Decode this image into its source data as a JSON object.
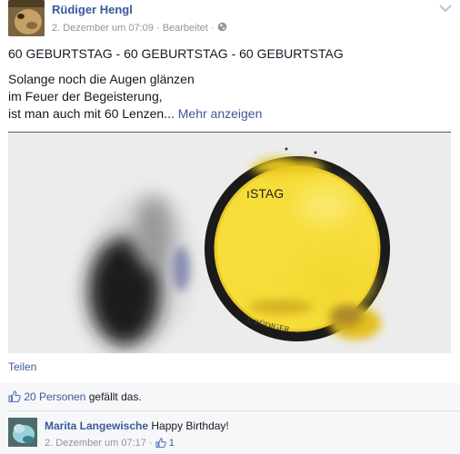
{
  "post": {
    "author_name": "Rüdiger Hengl",
    "date": "2. Dezember um 07:09",
    "separator": "·",
    "edited_label": "Bearbeitet",
    "separator2": "·",
    "headline": "60 GEBURTSTAG - 60 GEBURTSTAG - 60 GEBURTSTAG",
    "lines": [
      "Solange noch die Augen glänzen",
      "im Feuer der Begeisterung,",
      "ist man auch mit 60 Lenzen..."
    ],
    "see_more": "Mehr anzeigen"
  },
  "photo": {
    "plate_text_top": "STAG",
    "plate_text_bottom": "E RÜDIGER",
    "colors": {
      "plate": "#f7dd3a",
      "rim": "#1a1a1a",
      "background": "#ececec"
    }
  },
  "actions": {
    "share": "Teilen"
  },
  "likes": {
    "count_text": "20 Personen",
    "suffix": " gefällt das."
  },
  "comment": {
    "author": "Marita Langewische",
    "text": "Happy Birthday!",
    "date": "2. Dezember um 07:17",
    "separator": "·",
    "likes": "1"
  },
  "icons": {
    "menu": "chevron-down-icon",
    "audience": "globe-icon",
    "like": "thumb-up-icon"
  },
  "colors": {
    "link": "#3b5998",
    "meta": "#90949c",
    "feedback_bg": "#f6f7f9"
  }
}
